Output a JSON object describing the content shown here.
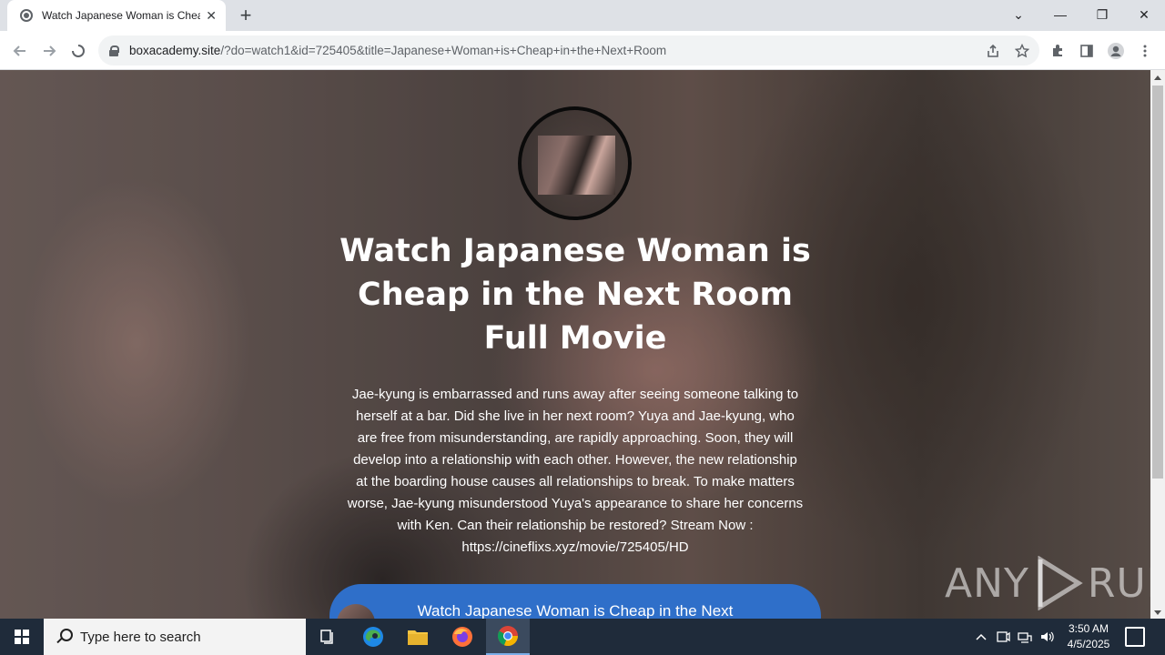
{
  "browser": {
    "tab": {
      "title": "Watch Japanese Woman is Cheap in the Next Room Full Movie",
      "close_label": "✕"
    },
    "new_tab_label": "+",
    "window_controls": {
      "tab_search": "⌄",
      "minimize": "—",
      "restore": "❐",
      "close": "✕"
    },
    "url": {
      "domain": "boxacademy.site",
      "path": "/?do=watch1&id=725405&title=Japanese+Woman+is+Cheap+in+the+Next+Room"
    }
  },
  "page": {
    "title": "Watch Japanese Woman is Cheap in the Next Room Full Movie",
    "description": "Jae-kyung is embarrassed and runs away after seeing someone talking to herself at a bar. Did she live in her next room? Yuya and Jae-kyung, who are free from misunderstanding, are rapidly approaching. Soon, they will develop into a relationship with each other. However, the new relationship at the boarding house causes all relationships to break. To make matters worse, Jae-kyung misunderstood Yuya's appearance to share her concerns with Ken. Can their relationship be restored? Stream Now : https://cineflixs.xyz/movie/725405/HD",
    "watch_button_label": "Watch Japanese Woman is Cheap in the Next"
  },
  "watermark": {
    "left": "ANY",
    "right": "RUN"
  },
  "taskbar": {
    "search_placeholder": "Type here to search",
    "time": "3:50 AM",
    "date": "4/5/2025"
  },
  "colors": {
    "accent_button": "#2f6fc9",
    "taskbar": "#1f2b3a",
    "chrome_frame": "#dee1e6"
  }
}
